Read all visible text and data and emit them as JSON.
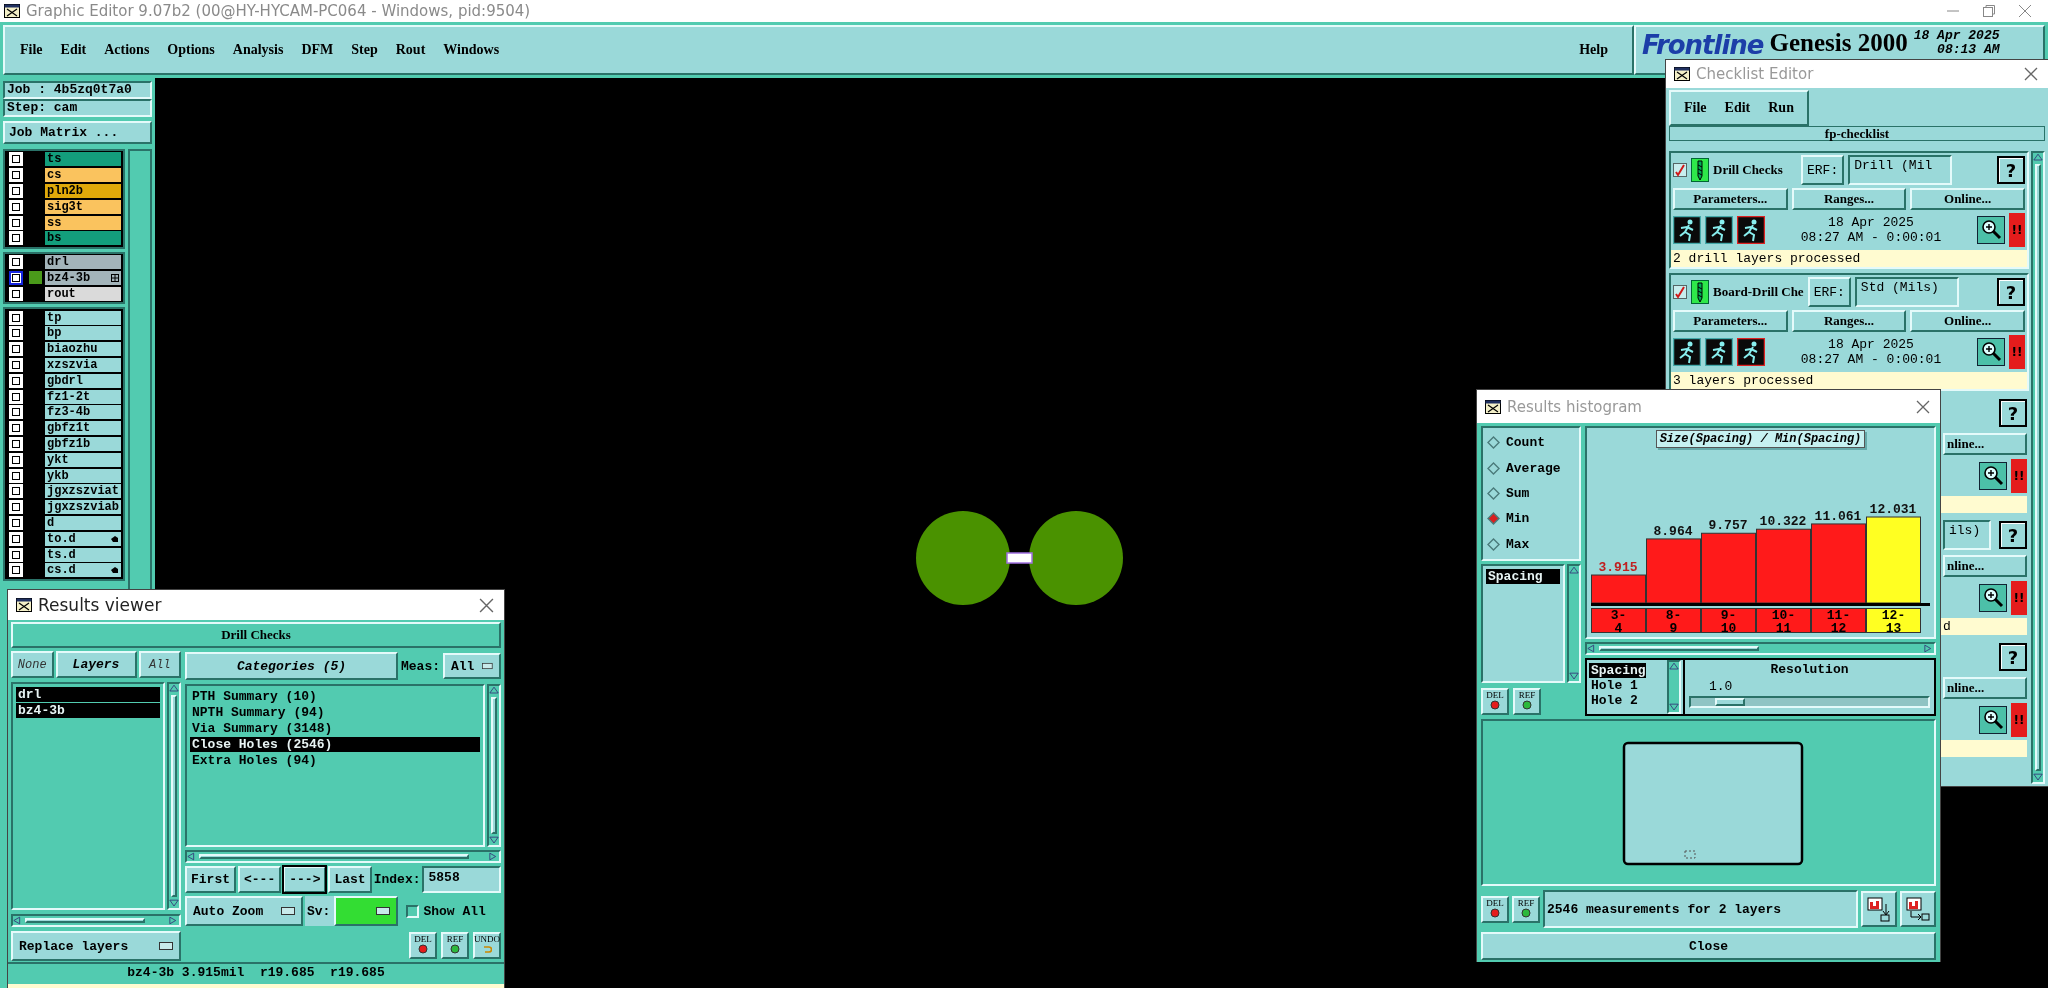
{
  "window": {
    "title": "Graphic Editor 9.07b2 (00@HY-HYCAM-PC064 - Windows, pid:9504)"
  },
  "menu": [
    "File",
    "Edit",
    "Actions",
    "Options",
    "Analysis",
    "DFM",
    "Step",
    "Rout",
    "Windows"
  ],
  "help": "Help",
  "brand": {
    "logo": "Frontline",
    "product": "Genesis 2000",
    "date": "18 Apr 2025",
    "time": "08:13 AM"
  },
  "job": {
    "job": "Job : 4b5zq0t7a0",
    "step": "Step: cam",
    "matrix_button": "Job Matrix ..."
  },
  "layer_groups": [
    {
      "layers": [
        {
          "name": "ts",
          "color": "#139e7c",
          "affected": false,
          "shown": false,
          "hand_mark": false,
          "plus_mark": false
        },
        {
          "name": "cs",
          "color": "#fac35e",
          "affected": false,
          "shown": false,
          "hand_mark": false,
          "plus_mark": false
        },
        {
          "name": "pln2b",
          "color": "#e0a90a",
          "affected": false,
          "shown": false,
          "hand_mark": false,
          "plus_mark": false
        },
        {
          "name": "sig3t",
          "color": "#fac35e",
          "affected": false,
          "shown": false,
          "hand_mark": false,
          "plus_mark": false
        },
        {
          "name": "ss",
          "color": "#fac35e",
          "affected": false,
          "shown": false,
          "hand_mark": false,
          "plus_mark": false
        },
        {
          "name": "bs",
          "color": "#139e7c",
          "affected": false,
          "shown": false,
          "hand_mark": false,
          "plus_mark": false
        }
      ]
    },
    {
      "layers": [
        {
          "name": "drl",
          "color": "#a3b4ba",
          "affected": false,
          "shown": false,
          "hand_mark": false,
          "plus_mark": false
        },
        {
          "name": "bz4-3b",
          "color": "#a3b4ba",
          "affected": true,
          "shown": true,
          "hand_mark": false,
          "plus_mark": true
        },
        {
          "name": "rout",
          "color": "#dadada",
          "affected": false,
          "shown": false,
          "hand_mark": false,
          "plus_mark": false
        }
      ]
    },
    {
      "layers": [
        {
          "name": "tp",
          "color": "#9ad9d9",
          "affected": false,
          "shown": false,
          "hand_mark": false,
          "plus_mark": false
        },
        {
          "name": "bp",
          "color": "#9ad9d9",
          "affected": false,
          "shown": false,
          "hand_mark": false,
          "plus_mark": false
        },
        {
          "name": "biaozhu",
          "color": "#9ad9d9",
          "affected": false,
          "shown": false,
          "hand_mark": false,
          "plus_mark": false
        },
        {
          "name": "xzszvia",
          "color": "#9ad9d9",
          "affected": false,
          "shown": false,
          "hand_mark": false,
          "plus_mark": false
        },
        {
          "name": "gbdrl",
          "color": "#9ad9d9",
          "affected": false,
          "shown": false,
          "hand_mark": false,
          "plus_mark": false
        },
        {
          "name": "fz1-2t",
          "color": "#9ad9d9",
          "affected": false,
          "shown": false,
          "hand_mark": false,
          "plus_mark": false
        },
        {
          "name": "fz3-4b",
          "color": "#9ad9d9",
          "affected": false,
          "shown": false,
          "hand_mark": false,
          "plus_mark": false
        },
        {
          "name": "gbfz1t",
          "color": "#9ad9d9",
          "affected": false,
          "shown": false,
          "hand_mark": false,
          "plus_mark": false
        },
        {
          "name": "gbfz1b",
          "color": "#9ad9d9",
          "affected": false,
          "shown": false,
          "hand_mark": false,
          "plus_mark": false
        },
        {
          "name": "ykt",
          "color": "#9ad9d9",
          "affected": false,
          "shown": false,
          "hand_mark": false,
          "plus_mark": false
        },
        {
          "name": "ykb",
          "color": "#9ad9d9",
          "affected": false,
          "shown": false,
          "hand_mark": false,
          "plus_mark": false
        },
        {
          "name": "jgxzszviat",
          "color": "#9ad9d9",
          "affected": false,
          "shown": false,
          "hand_mark": false,
          "plus_mark": false
        },
        {
          "name": "jgxzszviab",
          "color": "#9ad9d9",
          "affected": false,
          "shown": false,
          "hand_mark": false,
          "plus_mark": false
        },
        {
          "name": "d",
          "color": "#9ad9d9",
          "affected": false,
          "shown": false,
          "hand_mark": false,
          "plus_mark": false
        },
        {
          "name": "to.d",
          "color": "#9ad9d9",
          "affected": false,
          "shown": false,
          "hand_mark": true,
          "plus_mark": false
        },
        {
          "name": "ts.d",
          "color": "#9ad9d9",
          "affected": false,
          "shown": false,
          "hand_mark": false,
          "plus_mark": false
        },
        {
          "name": "cs.d",
          "color": "#9ad9d9",
          "affected": false,
          "shown": false,
          "hand_mark": true,
          "plus_mark": false
        }
      ]
    }
  ],
  "checklist": {
    "title": "Checklist Editor",
    "menu": [
      "File",
      "Edit",
      "Run"
    ],
    "name": "fp-checklist",
    "items": [
      {
        "enabled": true,
        "name": "Drill Checks",
        "erf_label": "ERF:",
        "erf": "Drill (Mil",
        "help": "?",
        "buttons": [
          "Parameters...",
          "Ranges...",
          "Online..."
        ],
        "date": "18 Apr 2025",
        "time": "08:27 AM - 0:00:01",
        "alert": "!!",
        "status": "2 drill layers processed"
      },
      {
        "enabled": true,
        "name": "Board-Drill Che",
        "erf_label": "ERF:",
        "erf": "Std (Mils)",
        "help": "?",
        "buttons": [
          "Parameters...",
          "Ranges...",
          "Online..."
        ],
        "date": "18 Apr 2025",
        "time": "08:27 AM - 0:00:01",
        "alert": "!!",
        "status": "3 layers processed"
      }
    ],
    "covered_items": [
      {
        "help": "?",
        "online_fragment": "nline...",
        "alert": "!!"
      },
      {
        "erf_fragment": "ils)",
        "help": "?",
        "online_fragment": "nline...",
        "alert": "!!",
        "status_fragment": "d"
      },
      {
        "help": "?",
        "online_fragment": "nline...",
        "alert": "!!"
      }
    ]
  },
  "histogram": {
    "title": "Results histogram",
    "modes": [
      {
        "label": "Count",
        "selected": false
      },
      {
        "label": "Average",
        "selected": false
      },
      {
        "label": "Sum",
        "selected": false
      },
      {
        "label": "Min",
        "selected": true
      },
      {
        "label": "Max",
        "selected": false
      }
    ],
    "measures": [
      {
        "name": "Spacing",
        "selected": true
      }
    ],
    "chart_title": "Size(Spacing) / Min(Spacing)",
    "chart_data": {
      "type": "bar",
      "categories": [
        "3- 4",
        "8- 9",
        "9- 10",
        "10- 11",
        "11- 12",
        "12- 13"
      ],
      "series": [
        {
          "values": [
            3.915,
            8.964,
            9.757,
            10.322,
            11.061,
            12.031
          ]
        }
      ],
      "data_labels": true
    },
    "bins": [
      {
        "color": "#ff1a1a",
        "emphasis": true
      },
      {
        "color": "#ff1a1a",
        "emphasis": false
      },
      {
        "color": "#ff1a1a",
        "emphasis": false
      },
      {
        "color": "#ff1a1a",
        "emphasis": false
      },
      {
        "color": "#ff1a1a",
        "emphasis": false
      },
      {
        "color": "#ffff22",
        "emphasis": false
      }
    ],
    "fields": [
      {
        "name": "Spacing",
        "selected": true
      },
      {
        "name": "Hole 1",
        "selected": false
      },
      {
        "name": "Hole 2",
        "selected": false
      }
    ],
    "resolution_label": "Resolution",
    "resolution": "1.0",
    "resolution_slider": {
      "level": 0.1
    },
    "list_actions": [
      "DEL",
      "REF"
    ],
    "actions": [
      "DEL",
      "REF"
    ],
    "message": "2546 measurements for 2 layers",
    "close": "Close"
  },
  "results_viewer": {
    "title": "Results viewer",
    "check": "Drill Checks",
    "layer_filter": [
      {
        "label": "None",
        "selected": false
      },
      {
        "label": "Layers",
        "selected": true
      },
      {
        "label": "All",
        "selected": false
      }
    ],
    "layers": [
      {
        "name": "drl",
        "selected": true
      },
      {
        "name": "bz4-3b",
        "selected": true
      }
    ],
    "categories_button": "Categories (5)",
    "meas_label": "Meas:",
    "meas_value": "All",
    "categories": [
      {
        "name": "PTH Summary (10)",
        "selected": false
      },
      {
        "name": "NPTH Summary (94)",
        "selected": false
      },
      {
        "name": "Via Summary (3148)",
        "selected": false
      },
      {
        "name": "Close Holes (2546)",
        "selected": true
      },
      {
        "name": "Extra Holes (94)",
        "selected": false
      }
    ],
    "nav": [
      {
        "label": "First",
        "selected": false
      },
      {
        "label": "<---",
        "selected": false
      },
      {
        "label": "--->",
        "selected": true
      },
      {
        "label": "Last",
        "selected": false
      }
    ],
    "index_label": "Index:",
    "index_value": "5858",
    "zoom_mode": "Auto Zoom",
    "sv_label": "Sv:",
    "show_all": {
      "label": "Show All",
      "checked": false
    },
    "replace_mode": "Replace layers",
    "actions": [
      "DEL",
      "REF",
      "UNDO"
    ],
    "status": "bz4-3b 3.915mil  r19.685  r19.685"
  }
}
